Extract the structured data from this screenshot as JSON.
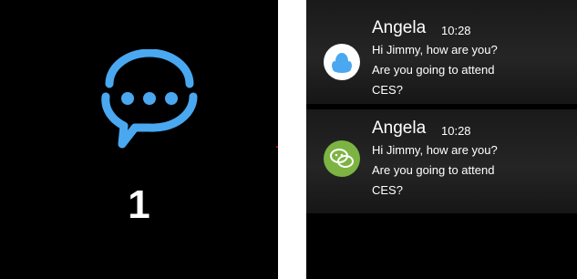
{
  "left_screen": {
    "icon": "chat-bubble-dots-icon",
    "unread_count": "1",
    "accent_color": "#4aa8f0"
  },
  "notifications": [
    {
      "app_icon": "qq-penguin-icon",
      "sender": "Angela",
      "time": "10:28",
      "message_lines": [
        "Hi Jimmy, how are you?",
        "Are you going to attend",
        "CES?"
      ]
    },
    {
      "app_icon": "wechat-icon",
      "sender": "Angela",
      "time": "10:28",
      "message_lines": [
        "Hi Jimmy, how are you?",
        "Are you going to attend",
        "CES?"
      ]
    }
  ]
}
